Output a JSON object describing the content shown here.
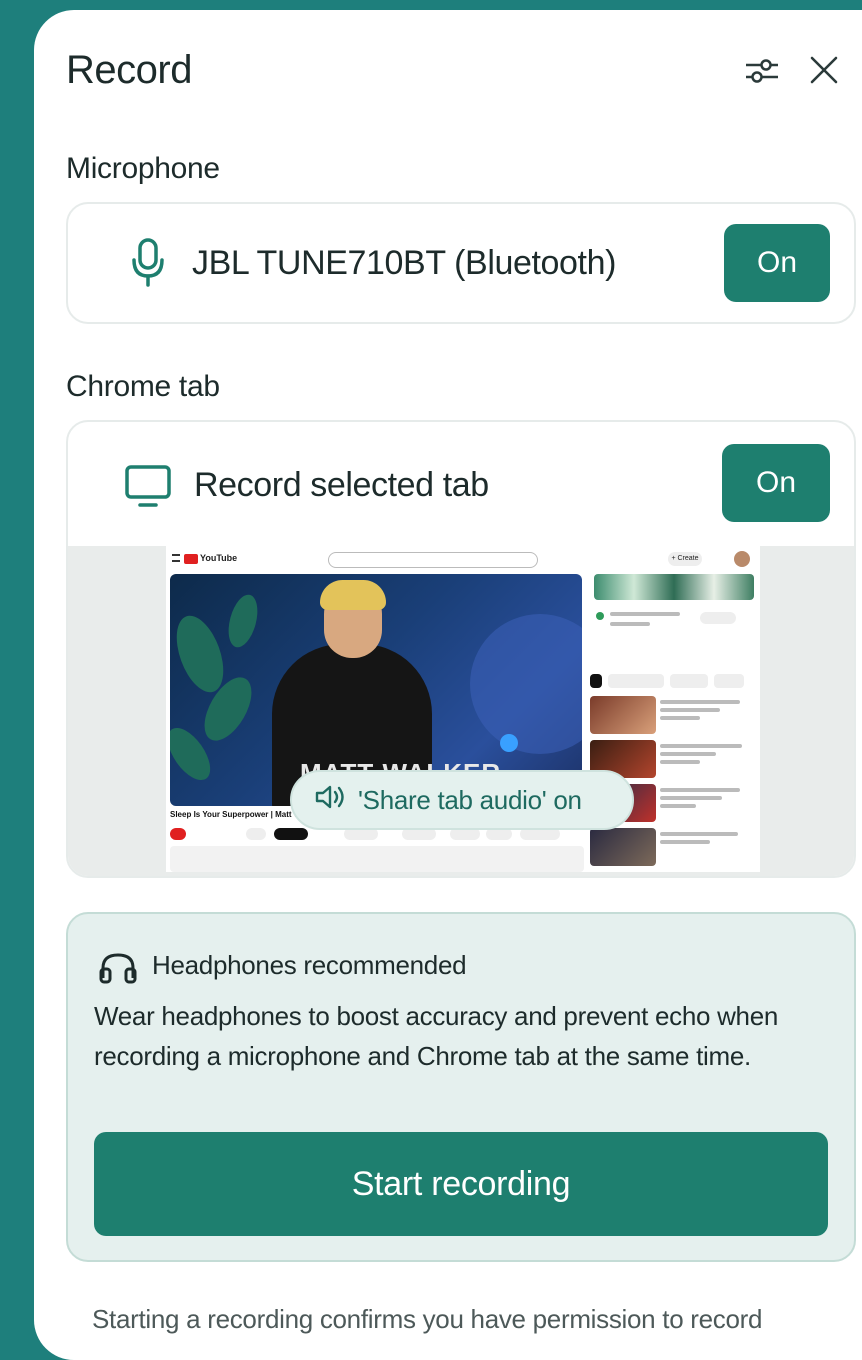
{
  "panel": {
    "title": "Record",
    "settings_icon": "sliders-icon",
    "close_icon": "close-icon"
  },
  "microphone": {
    "section_label": "Microphone",
    "icon": "microphone-icon",
    "device_name": "JBL TUNE710BT (Bluetooth)",
    "toggle_label": "On"
  },
  "chrome_tab": {
    "section_label": "Chrome tab",
    "icon": "monitor-icon",
    "option_label": "Record selected tab",
    "toggle_label": "On",
    "preview": {
      "site_logo": "YouTube",
      "video_title": "Sleep Is Your Superpower | Matt Wa",
      "lower_third": "MATT WALKER",
      "create_label": "+ Create"
    },
    "share_audio_label": "'Share tab audio' on",
    "share_audio_icon": "speaker-icon"
  },
  "tip": {
    "icon": "headphones-icon",
    "title": "Headphones recommended",
    "body": "Wear headphones to boost accuracy and prevent echo when recording a microphone and Chrome tab at the same time.",
    "button_label": "Start recording"
  },
  "footer": {
    "text": "Starting a recording confirms you have permission to record"
  },
  "colors": {
    "background": "#1e7f7c",
    "accent": "#1e7f6f",
    "tip_bg": "#e5f0ee"
  }
}
